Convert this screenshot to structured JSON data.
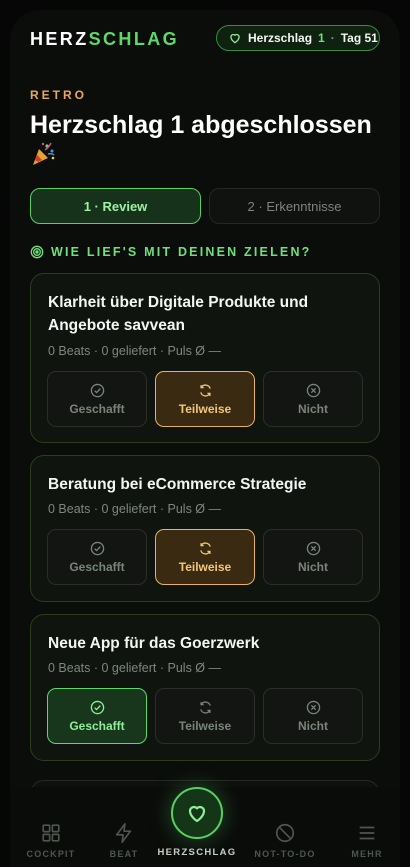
{
  "header": {
    "logo_part1": "HERZ",
    "logo_part2": "SCHLAG",
    "status": {
      "label": "Herzschlag",
      "count": "1",
      "separator": "·",
      "day": "Tag 51"
    }
  },
  "retro": {
    "eyebrow": "RETRO",
    "title": "Herzschlag 1 abgeschlossen",
    "emoji_icon": "party-popper-icon"
  },
  "tabs": [
    {
      "label": "1 · Review",
      "active": true
    },
    {
      "label": "2 · Erkenntnisse",
      "active": false
    }
  ],
  "section": {
    "heading": "WIE LIEF'S MIT DEINEN ZIELEN?",
    "icon": "target-icon"
  },
  "goals": [
    {
      "title": "Klarheit über Digitale Produkte und Angebote savvean",
      "meta": "0 Beats · 0 geliefert · Puls Ø —",
      "selected": "Teilweise"
    },
    {
      "title": "Beratung bei eCommerce Strategie",
      "meta": "0 Beats · 0 geliefert · Puls Ø —",
      "selected": "Teilweise"
    },
    {
      "title": "Neue App für das Goerzwerk",
      "meta": "0 Beats · 0 geliefert · Puls Ø —",
      "selected": "Geschafft"
    }
  ],
  "options": {
    "done": "Geschafft",
    "partial": "Teilweise",
    "not": "Nicht"
  },
  "nav": {
    "cockpit": "COCKPIT",
    "beat": "BEAT",
    "herzschlag": "HERZSCHLAG",
    "not_to_do": "NOT-TO-DO",
    "mehr": "MEHR"
  },
  "colors": {
    "accent_green": "#5fd86a",
    "accent_orange": "#e8b25e",
    "eyebrow": "#e8a85a",
    "background": "#0b0d0b"
  }
}
